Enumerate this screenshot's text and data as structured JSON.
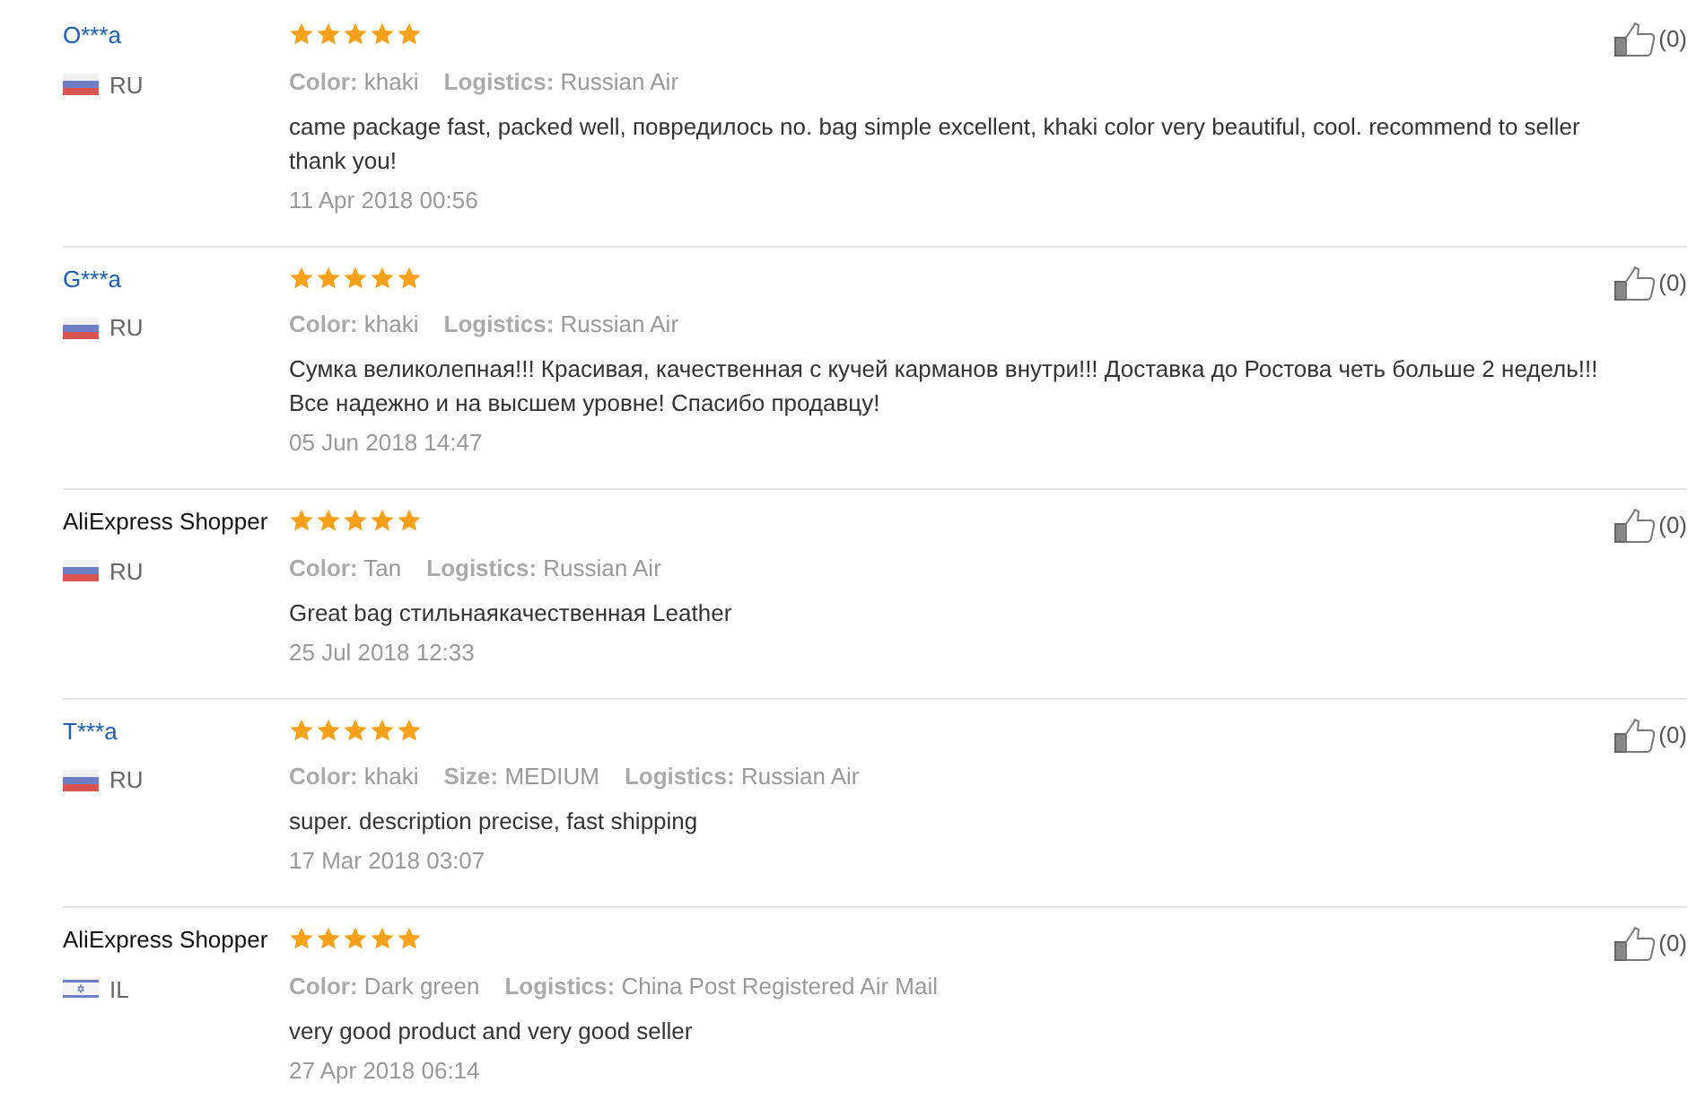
{
  "reviews": [
    {
      "reviewer": "O***a",
      "linked": true,
      "flag": {
        "kind": "russia"
      },
      "country": "RU",
      "stars": 5,
      "attributes": [
        {
          "label": "Color:",
          "value": "khaki"
        },
        {
          "label": "Logistics:",
          "value": "Russian Air"
        }
      ],
      "comment": "came package fast, packed well, повредилось no. bag simple excellent, khaki color very beautiful, cool. recommend to seller thank you!",
      "date": "11 Apr 2018 00:56",
      "helpful": "(0)"
    },
    {
      "reviewer": "G***a",
      "linked": true,
      "flag": {
        "kind": "russia"
      },
      "country": "RU",
      "stars": 5,
      "attributes": [
        {
          "label": "Color:",
          "value": "khaki"
        },
        {
          "label": "Logistics:",
          "value": "Russian Air"
        }
      ],
      "comment": "Сумка великолепная!!! Красивая, качественная с кучей карманов внутри!!! Доставка до Ростова четь больше 2 недель!!! Все надежно и на высшем уровне! Спасибо продавцу!",
      "date": "05 Jun 2018 14:47",
      "helpful": "(0)"
    },
    {
      "reviewer": "AliExpress Shopper",
      "linked": false,
      "flag": {
        "kind": "russia"
      },
      "country": "RU",
      "stars": 5,
      "attributes": [
        {
          "label": "Color:",
          "value": "Tan"
        },
        {
          "label": "Logistics:",
          "value": "Russian Air"
        }
      ],
      "comment": "Great bag стильнаякачественная Leather",
      "date": "25 Jul 2018 12:33",
      "helpful": "(0)"
    },
    {
      "reviewer": "T***a",
      "linked": true,
      "flag": {
        "kind": "russia"
      },
      "country": "RU",
      "stars": 5,
      "attributes": [
        {
          "label": "Color:",
          "value": "khaki"
        },
        {
          "label": "Size:",
          "value": "MEDIUM"
        },
        {
          "label": "Logistics:",
          "value": "Russian Air"
        }
      ],
      "comment": "super. description precise, fast shipping",
      "date": "17 Mar 2018 03:07",
      "helpful": "(0)"
    },
    {
      "reviewer": "AliExpress Shopper",
      "linked": false,
      "flag": {
        "kind": "israel"
      },
      "country": "IL",
      "stars": 5,
      "attributes": [
        {
          "label": "Color:",
          "value": "Dark green"
        },
        {
          "label": "Logistics:",
          "value": "China Post Registered Air Mail"
        }
      ],
      "comment": "very good product and very good seller",
      "date": "27 Apr 2018 06:14",
      "helpful": "(0)"
    }
  ]
}
